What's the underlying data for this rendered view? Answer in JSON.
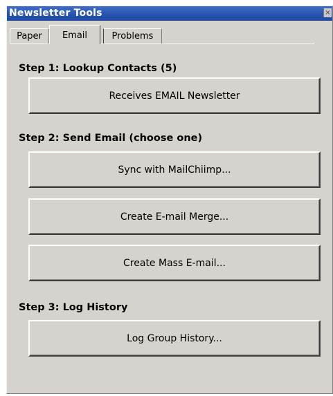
{
  "window": {
    "title": "Newsletter Tools",
    "close_glyph": "×"
  },
  "tabs": [
    {
      "label": "Paper",
      "active": false
    },
    {
      "label": "Email",
      "active": true
    },
    {
      "label": "Problems",
      "active": false
    }
  ],
  "steps": {
    "step1": {
      "heading": "Step 1:  Lookup Contacts (5)",
      "button": "Receives EMAIL Newsletter"
    },
    "step2": {
      "heading": "Step 2:  Send Email (choose one)",
      "buttons": [
        "Sync with MailChiimp...",
        "Create E-mail Merge...",
        "Create Mass E-mail..."
      ]
    },
    "step3": {
      "heading": "Step 3:  Log History",
      "button": "Log Group History..."
    }
  },
  "colors": {
    "titlebar": "#2a55b0",
    "panel": "#d6d3ce"
  }
}
